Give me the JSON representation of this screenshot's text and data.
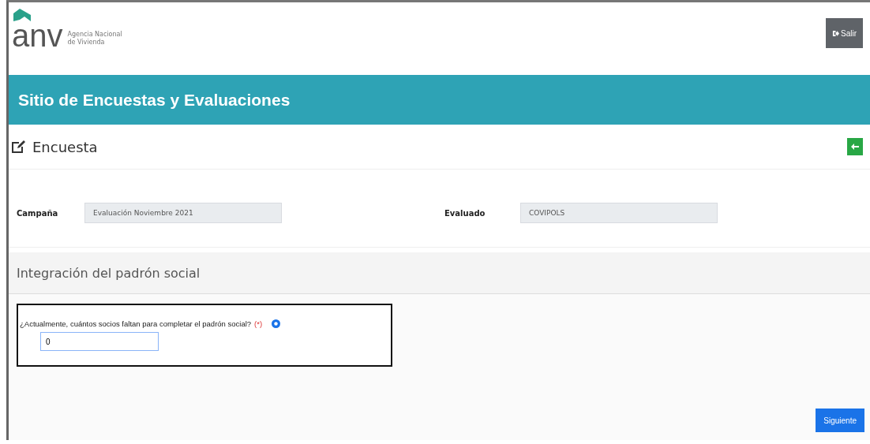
{
  "header": {
    "logo_text": "anv",
    "logo_subtitle": [
      "Agencia Nacional",
      "de Vivienda"
    ],
    "logout_button": "Salir"
  },
  "banner": {
    "title": "Sitio de Encuestas y Evaluaciones"
  },
  "page": {
    "title": "Encuesta"
  },
  "fields": [
    {
      "label": "Campaña",
      "value": "Evaluación Noviembre 2021"
    },
    {
      "label": "Evaluado",
      "value": "COVIPOLS"
    }
  ],
  "section": {
    "title": "Integración del padrón social"
  },
  "question": {
    "text": "¿Actualmente, cuántos socios faltan para completar el padrón social?",
    "required_mark": "(*)",
    "value": "0"
  },
  "footer": {
    "next_button": "Siguiente"
  }
}
